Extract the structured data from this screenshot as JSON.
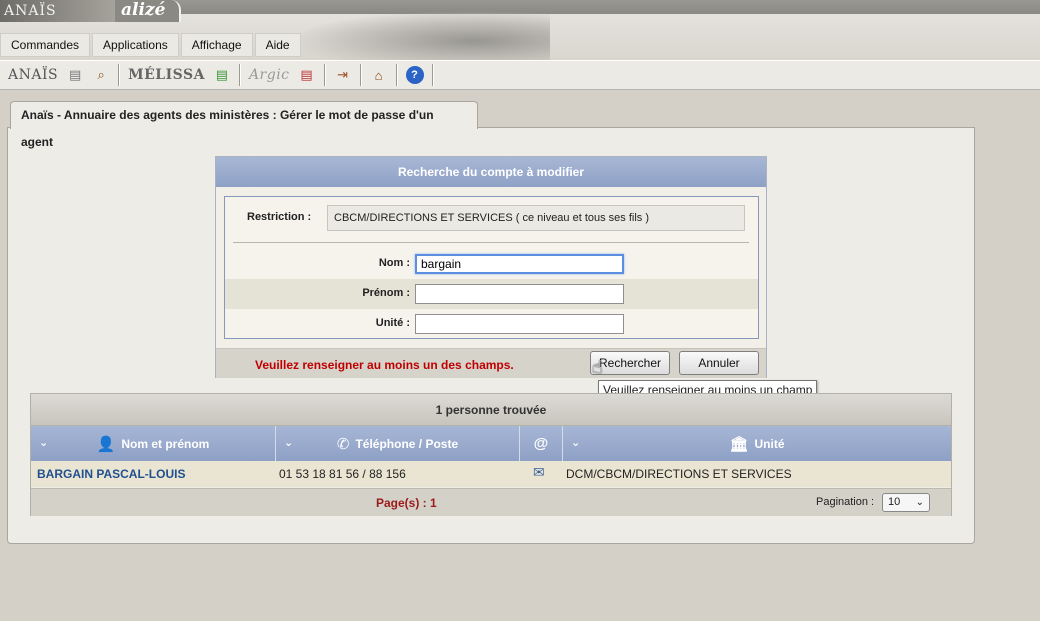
{
  "app": {
    "brand_anais": "ANAÏS",
    "brand_alize": "alizé"
  },
  "menu": [
    {
      "label": "Commandes"
    },
    {
      "label": "Applications"
    },
    {
      "label": "Affichage"
    },
    {
      "label": "Aide"
    }
  ],
  "toolbar": {
    "anais": "ANAÏS",
    "melissa": "MÉLISSA",
    "argic": "Argic"
  },
  "tab": {
    "title": "Anaïs - Annuaire des agents des ministères : Gérer le mot de passe d'un agent"
  },
  "search": {
    "title": "Recherche du compte à modifier",
    "restriction_label": "Restriction :",
    "restriction_value": "CBCM/DIRECTIONS ET SERVICES ( ce niveau et tous ses fils )",
    "nom_label": "Nom :",
    "nom_value": "bargain",
    "prenom_label": "Prénom :",
    "prenom_value": "",
    "unite_label": "Unité :",
    "unite_value": "",
    "warning": "Veuillez renseigner au moins un des champs.",
    "search_button": "Rechercher",
    "cancel_button": "Annuler",
    "tooltip": "Veuillez renseigner au moins un champ"
  },
  "results": {
    "title": "1 personne trouvée",
    "columns": [
      "Nom et prénom",
      "Téléphone / Poste",
      "@",
      "Unité"
    ],
    "rows": [
      {
        "name": "BARGAIN PASCAL-LOUIS",
        "phone": "01 53 18 81 56  /  88 156",
        "unit": "DCM/CBCM/DIRECTIONS ET SERVICES"
      }
    ],
    "pages_text": "Page(s) :  1",
    "pagination_label": "Pagination  :",
    "pagination_value": "10"
  },
  "colors": {
    "header_blue": "#8ea1c6",
    "warning_red": "#c00000",
    "link_blue": "#21508f"
  }
}
